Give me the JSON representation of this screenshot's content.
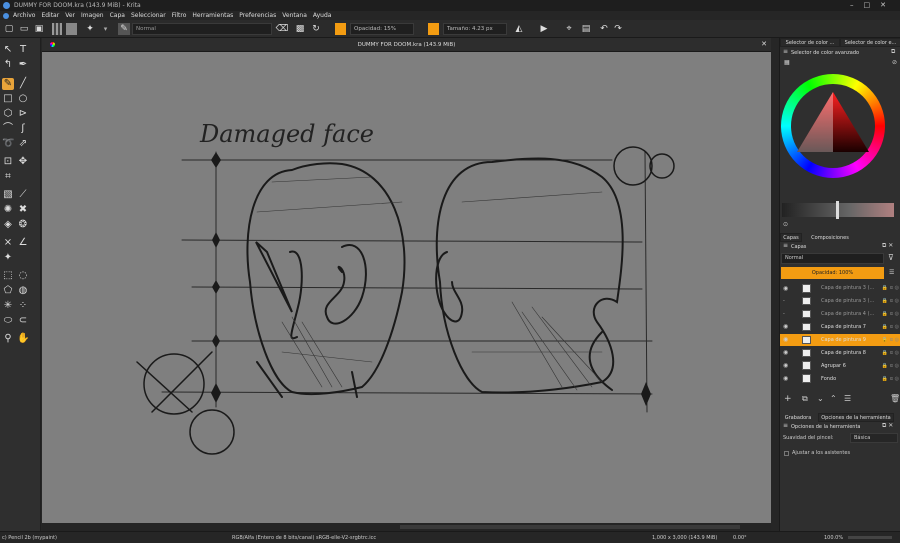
{
  "titlebar": {
    "title": "DUMMY FOR DOOM.kra (143.9 MiB) - Krita"
  },
  "menu": [
    "Archivo",
    "Editar",
    "Ver",
    "Imagen",
    "Capa",
    "Seleccionar",
    "Filtro",
    "Herramientas",
    "Preferencias",
    "Ventana",
    "Ayuda"
  ],
  "toolbar": {
    "blend_mode": "Normal",
    "opacity": "Opacidad: 15%",
    "size": "Tamaño: 4.23 px"
  },
  "document": {
    "tab_title": "DUMMY FOR DOOM.kra (143.9 MiB)"
  },
  "canvas": {
    "sketch_text": "Damaged face"
  },
  "dock": {
    "color_tabs": [
      "Selector de color ...",
      "Selector de color e..."
    ],
    "color_panel_title": "Selector de color avanzado",
    "layer_tabs": [
      "Capas",
      "Composiciones"
    ],
    "layers_title": "Capas",
    "blend_mode": "Normal",
    "opacity": "Opacidad: 100%",
    "layers": [
      {
        "name": "Capa de pintura 3 (...",
        "visible": true,
        "active": false,
        "bright": false
      },
      {
        "name": "Capa de pintura 3 (...",
        "visible": false,
        "active": false,
        "bright": false
      },
      {
        "name": "Capa de pintura 4 (...",
        "visible": false,
        "active": false,
        "bright": false
      },
      {
        "name": "Capa de pintura 7",
        "visible": true,
        "active": false,
        "bright": true
      },
      {
        "name": "Capa de pintura 9",
        "visible": true,
        "active": true,
        "bright": true
      },
      {
        "name": "Capa de pintura 8",
        "visible": true,
        "active": false,
        "bright": true
      },
      {
        "name": "Agrupar 6",
        "visible": true,
        "active": false,
        "bright": true
      },
      {
        "name": "Fondo",
        "visible": true,
        "active": false,
        "bright": true
      }
    ],
    "tool_tabs": [
      "Grabadora",
      "Opciones de la herramienta"
    ],
    "tool_options_title": "Opciones de la herramienta",
    "smoothing_label": "Suavidad del pincel:",
    "smoothing_value": "Básica",
    "snap_label": "Ajustar a los asistentes"
  },
  "status": {
    "brush": "c) Pencil 2b (mypaint)",
    "colorspace": "RGB/Alfa (Entero de 8 bits/canal)  sRGB-elle-V2-srgbtrc.icc",
    "dims": "1,000 x 3,000 (143.9 MiB)",
    "rotation": "0.00°",
    "zoom": "100.0%"
  }
}
